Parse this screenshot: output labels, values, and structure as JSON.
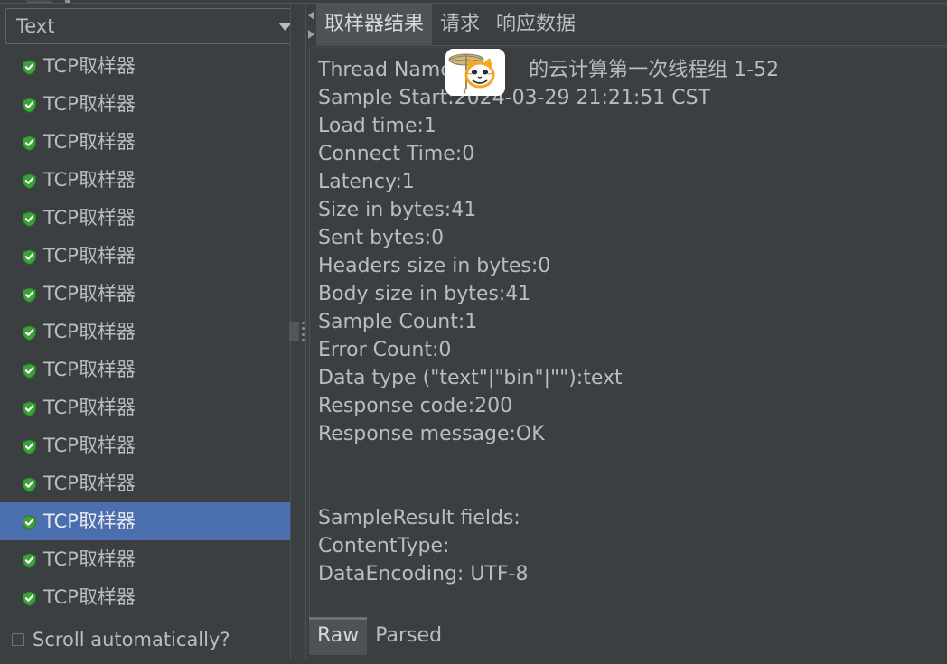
{
  "window": {
    "accent_selection": "#4b6eaf",
    "background": "#3c3f41",
    "text_color": "#b7bdc2",
    "shield_green": "#3ba238"
  },
  "left_panel": {
    "combo": {
      "value": "Text",
      "arrow_icon": "chevron-down-icon"
    },
    "tree_items": [
      {
        "label": "TCP取样器",
        "icon": "shield-check-icon",
        "selected": false
      },
      {
        "label": "TCP取样器",
        "icon": "shield-check-icon",
        "selected": false
      },
      {
        "label": "TCP取样器",
        "icon": "shield-check-icon",
        "selected": false
      },
      {
        "label": "TCP取样器",
        "icon": "shield-check-icon",
        "selected": false
      },
      {
        "label": "TCP取样器",
        "icon": "shield-check-icon",
        "selected": false
      },
      {
        "label": "TCP取样器",
        "icon": "shield-check-icon",
        "selected": false
      },
      {
        "label": "TCP取样器",
        "icon": "shield-check-icon",
        "selected": false
      },
      {
        "label": "TCP取样器",
        "icon": "shield-check-icon",
        "selected": false
      },
      {
        "label": "TCP取样器",
        "icon": "shield-check-icon",
        "selected": false
      },
      {
        "label": "TCP取样器",
        "icon": "shield-check-icon",
        "selected": false
      },
      {
        "label": "TCP取样器",
        "icon": "shield-check-icon",
        "selected": false
      },
      {
        "label": "TCP取样器",
        "icon": "shield-check-icon",
        "selected": false
      },
      {
        "label": "TCP取样器",
        "icon": "shield-check-icon",
        "selected": true
      },
      {
        "label": "TCP取样器",
        "icon": "shield-check-icon",
        "selected": false
      },
      {
        "label": "TCP取样器",
        "icon": "shield-check-icon",
        "selected": false
      }
    ],
    "scroll_automatically": {
      "label": "Scroll automatically?",
      "checked": false
    }
  },
  "splitter": {
    "grip_icon": "vertical-dots-grip-icon"
  },
  "right_panel": {
    "tab_scroll_left_icon": "triangle-left-icon",
    "tab_scroll_right_icon": "triangle-right-icon",
    "tabs": [
      {
        "label": "取样器结果",
        "active": true
      },
      {
        "label": "请求",
        "active": false
      },
      {
        "label": "响应数据",
        "active": false
      }
    ],
    "result_lines": [
      "Thread Name:           的云计算第一次线程组 1-52",
      "Sample Start:2024-03-29 21:21:51 CST",
      "Load time:1",
      "Connect Time:0",
      "Latency:1",
      "Size in bytes:41",
      "Sent bytes:0",
      "Headers size in bytes:0",
      "Body size in bytes:41",
      "Sample Count:1",
      "Error Count:0",
      "Data type (\"text\"|\"bin\"|\"\"):text",
      "Response code:200",
      "Response message:OK",
      "",
      "",
      "SampleResult fields:",
      "ContentType:",
      "DataEncoding: UTF-8"
    ],
    "sticker": {
      "icon": "cat-with-parasol-sticker-icon"
    },
    "bottom_tabs": [
      {
        "label": "Raw",
        "active": true
      },
      {
        "label": "Parsed",
        "active": false
      }
    ]
  }
}
